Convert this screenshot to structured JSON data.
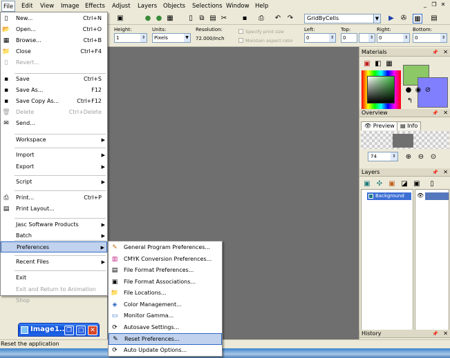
{
  "menubar": {
    "items": [
      "File",
      "Edit",
      "View",
      "Image",
      "Effects",
      "Adjust",
      "Layers",
      "Objects",
      "Selections",
      "Window",
      "Help"
    ]
  },
  "toolbar": {
    "grid_combo_value": "GridByCells"
  },
  "options": {
    "height_label": "Height:",
    "height_value": "1",
    "units_label": "Units:",
    "units_value": "Pixels",
    "resolution_label": "Resolution:",
    "resolution_value": "72.000",
    "resolution_unit": "/inch",
    "specify_print_size": "Specify print size",
    "maintain_aspect_ratio": "Maintain aspect ratio",
    "left_label": "Left:",
    "left_value": "0",
    "top_label": "Top:",
    "top_value": "0",
    "right_label": "Right:",
    "right_value": "0",
    "bottom_label": "Bottom:",
    "bottom_value": "0"
  },
  "palettes": {
    "materials_title": "Materials",
    "overview_title": "Overview",
    "preview_tab": "Preview",
    "info_tab": "Info",
    "zoom_value": "74",
    "layers_title": "Layers",
    "layer_name": "Background",
    "history_title": "History"
  },
  "file_menu": {
    "items": [
      {
        "label": "New...",
        "shortcut": "Ctrl+N",
        "icon": "new-document-icon"
      },
      {
        "label": "Open...",
        "shortcut": "Ctrl+O",
        "icon": "open-folder-icon"
      },
      {
        "label": "Browse...",
        "shortcut": "Ctrl+B",
        "icon": "browse-icon"
      },
      {
        "label": "Close",
        "shortcut": "Ctrl+F4",
        "icon": "close-folder-icon"
      },
      {
        "label": "Revert...",
        "shortcut": "",
        "icon": "revert-icon"
      },
      {
        "label": "Save",
        "shortcut": "Ctrl+S",
        "icon": "save-disk-icon"
      },
      {
        "label": "Save As...",
        "shortcut": "F12",
        "icon": "save-as-icon"
      },
      {
        "label": "Save Copy As...",
        "shortcut": "Ctrl+F12",
        "icon": "save-copy-icon"
      },
      {
        "label": "Delete",
        "shortcut": "Ctrl+Delete",
        "icon": "trash-icon"
      },
      {
        "label": "Send...",
        "shortcut": "",
        "icon": "send-mail-icon"
      },
      {
        "label": "Workspace",
        "shortcut": "",
        "icon": ""
      },
      {
        "label": "Import",
        "shortcut": "",
        "icon": ""
      },
      {
        "label": "Export",
        "shortcut": "",
        "icon": ""
      },
      {
        "label": "Script",
        "shortcut": "",
        "icon": ""
      },
      {
        "label": "Print...",
        "shortcut": "Ctrl+P",
        "icon": "printer-icon"
      },
      {
        "label": "Print Layout...",
        "shortcut": "",
        "icon": "print-layout-icon"
      },
      {
        "label": "Jasc Software Products",
        "shortcut": "",
        "icon": ""
      },
      {
        "label": "Batch",
        "shortcut": "",
        "icon": ""
      },
      {
        "label": "Preferences",
        "shortcut": "",
        "icon": ""
      },
      {
        "label": "Recent Files",
        "shortcut": "",
        "icon": ""
      },
      {
        "label": "Exit",
        "shortcut": "",
        "icon": ""
      },
      {
        "label": "Exit and Return to Animation Shop",
        "shortcut": "",
        "icon": ""
      }
    ]
  },
  "preferences_menu": {
    "items": [
      {
        "label": "General Program Preferences...",
        "icon": "general-prefs-icon"
      },
      {
        "label": "CMYK Conversion Preferences...",
        "icon": "cmyk-icon"
      },
      {
        "label": "File Format Preferences...",
        "icon": "file-format-icon"
      },
      {
        "label": "File Format Associations...",
        "icon": "file-assoc-icon"
      },
      {
        "label": "File Locations...",
        "icon": "file-locations-icon"
      },
      {
        "label": "Color Management...",
        "icon": "color-management-icon"
      },
      {
        "label": "Monitor Gamma...",
        "icon": "monitor-gamma-icon"
      },
      {
        "label": "Autosave Settings...",
        "icon": "autosave-icon"
      },
      {
        "label": "Reset Preferences...",
        "icon": "reset-prefs-icon"
      },
      {
        "label": "Auto Update Options...",
        "icon": "auto-update-icon"
      }
    ]
  },
  "minimized_doc": {
    "title": "Image1..."
  },
  "statusbar": {
    "text": "Reset the application"
  },
  "colors": {
    "foreground": "#8cc865",
    "background": "#8080ff",
    "workspace": "#6f6f6f",
    "highlight": "#c1d2ee"
  }
}
